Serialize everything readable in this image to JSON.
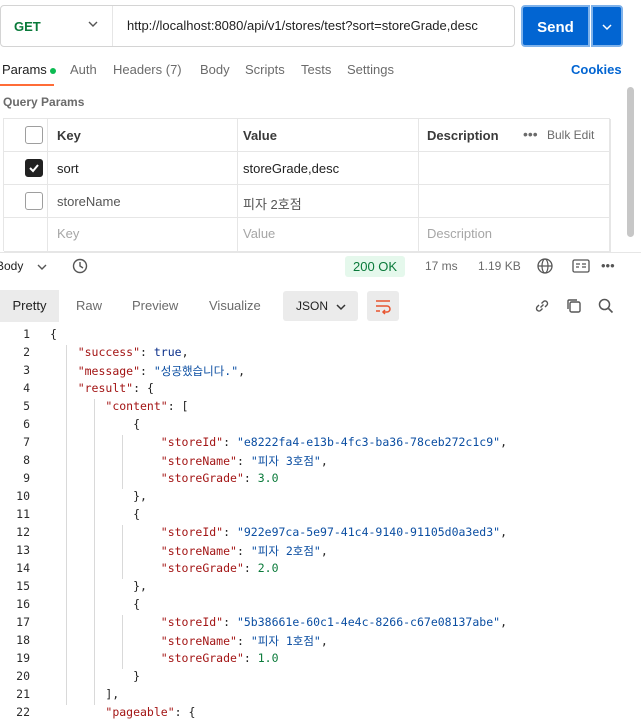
{
  "request": {
    "method": "GET",
    "url": "http://localhost:8080/api/v1/stores/test?sort=storeGrade,desc",
    "send_label": "Send"
  },
  "tabs": [
    {
      "label": "Params"
    },
    {
      "label": "Auth"
    },
    {
      "label": "Headers (7)"
    },
    {
      "label": "Body"
    },
    {
      "label": "Scripts"
    },
    {
      "label": "Tests"
    },
    {
      "label": "Settings"
    }
  ],
  "cookies_label": "Cookies",
  "query_params": {
    "title": "Query Params",
    "headers": {
      "key": "Key",
      "value": "Value",
      "description": "Description",
      "bulk_edit": "Bulk Edit"
    },
    "rows": [
      {
        "checked": true,
        "key": "sort",
        "value": "storeGrade,desc",
        "description": ""
      },
      {
        "checked": false,
        "key": "storeName",
        "value": "피자 2호점",
        "description": ""
      }
    ],
    "placeholder": {
      "key": "Key",
      "value": "Value",
      "description": "Description"
    }
  },
  "response": {
    "body_tab": "Body",
    "status": "200 OK",
    "time": "17 ms",
    "size": "1.19 KB",
    "view_tabs": [
      "Pretty",
      "Raw",
      "Preview",
      "Visualize"
    ],
    "format": "JSON"
  },
  "code_lines": [
    "{",
    "    \"success\": true,",
    "    \"message\": \"성공했습니다.\",",
    "    \"result\": {",
    "        \"content\": [",
    "            {",
    "                \"storeId\": \"e8222fa4-e13b-4fc3-ba36-78ceb272c1c9\",",
    "                \"storeName\": \"피자 3호점\",",
    "                \"storeGrade\": 3.0",
    "            },",
    "            {",
    "                \"storeId\": \"922e97ca-5e97-41c4-9140-91105d0a3ed3\",",
    "                \"storeName\": \"피자 2호점\",",
    "                \"storeGrade\": 2.0",
    "            },",
    "            {",
    "                \"storeId\": \"5b38661e-60c1-4e4c-8266-c67e08137abe\",",
    "                \"storeName\": \"피자 1호점\",",
    "                \"storeGrade\": 1.0",
    "            }",
    "        ],",
    "        \"pageable\": {"
  ],
  "colors": {
    "accent": "#0265d2",
    "tab_indicator": "#ff6c37",
    "status_ok": "#0a7a3a"
  }
}
